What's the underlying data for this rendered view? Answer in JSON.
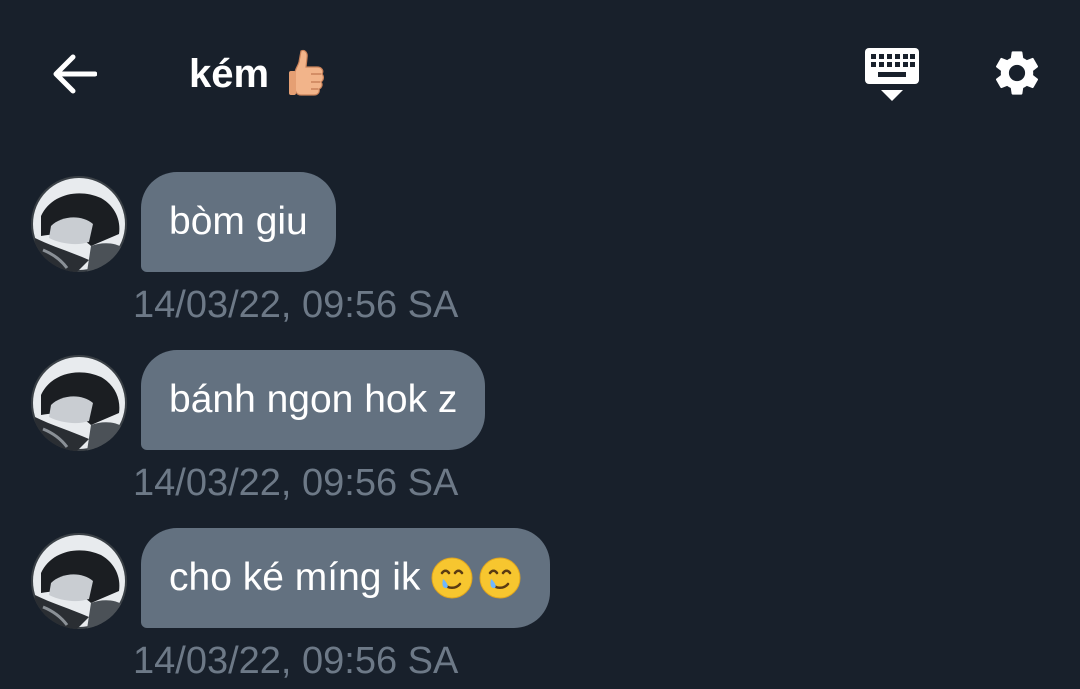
{
  "header": {
    "back_icon": "arrow-left-icon",
    "title": "kém",
    "title_emoji": "thumbs-up-emoji",
    "keyboard_icon": "keyboard-hide-icon",
    "settings_icon": "gear-icon"
  },
  "messages": [
    {
      "text": "bòm giu",
      "timestamp": "14/03/22, 09:56 SA"
    },
    {
      "text": "bánh ngon hok z",
      "timestamp": "14/03/22, 09:56 SA"
    },
    {
      "text": "cho ké míng ik",
      "emoji_count": 2,
      "emoji": "smiling-face-with-tear-emoji",
      "timestamp": "14/03/22, 09:56 SA"
    }
  ],
  "colors": {
    "background": "#18202b",
    "bubble": "#637180",
    "timestamp": "#6d7987",
    "text": "#ffffff"
  }
}
